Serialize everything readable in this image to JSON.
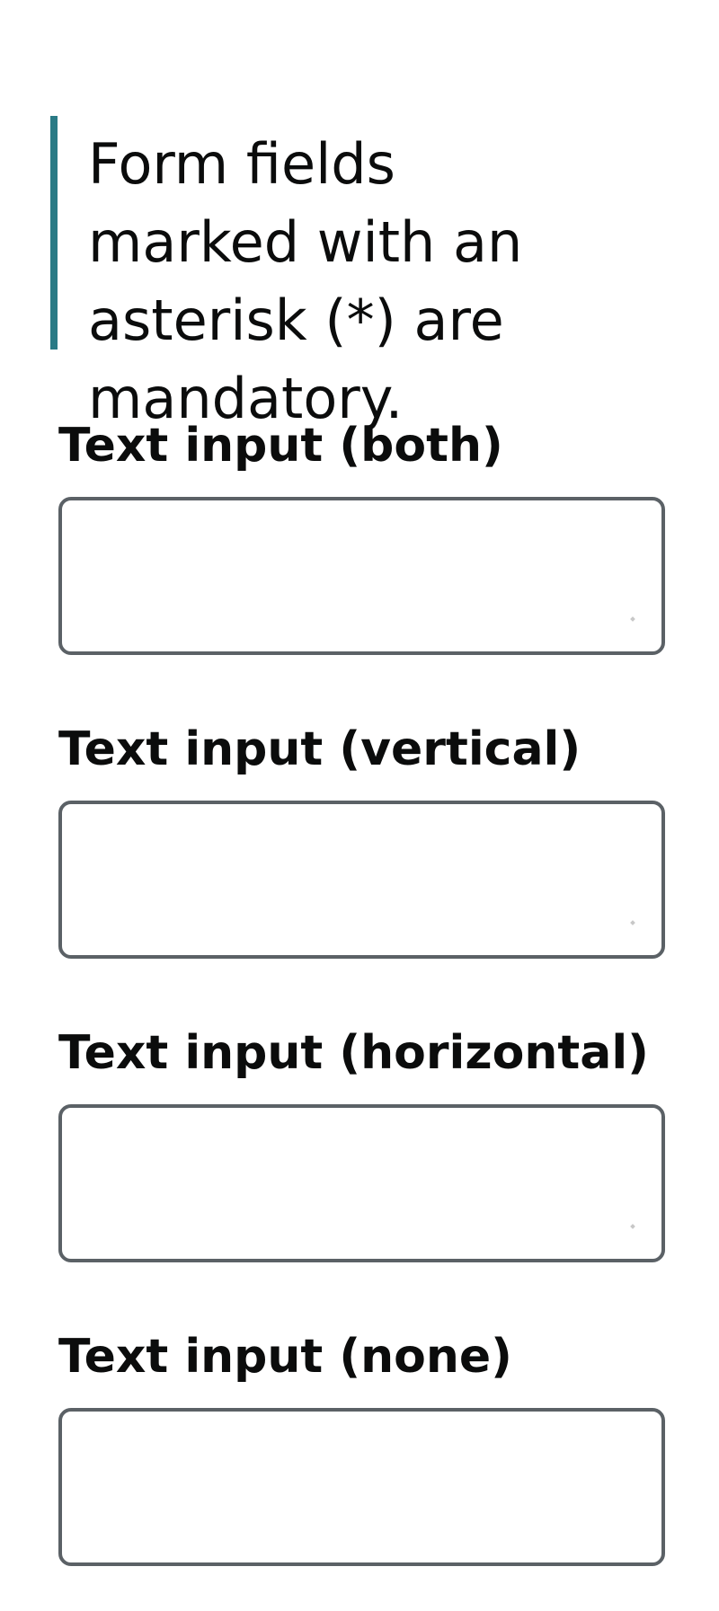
{
  "notice": {
    "text": "Form fields marked with an asterisk (*) are mandatory."
  },
  "fields": [
    {
      "label": "Text input (both)",
      "value": "",
      "resize": "both"
    },
    {
      "label": "Text input (vertical)",
      "value": "",
      "resize": "vertical"
    },
    {
      "label": "Text input (horizontal)",
      "value": "",
      "resize": "horizontal"
    },
    {
      "label": "Text input (none)",
      "value": "",
      "resize": "none"
    }
  ],
  "colors": {
    "notice_border": "#2a7a85",
    "input_border": "#5b6166",
    "text": "#0b0c0c"
  }
}
